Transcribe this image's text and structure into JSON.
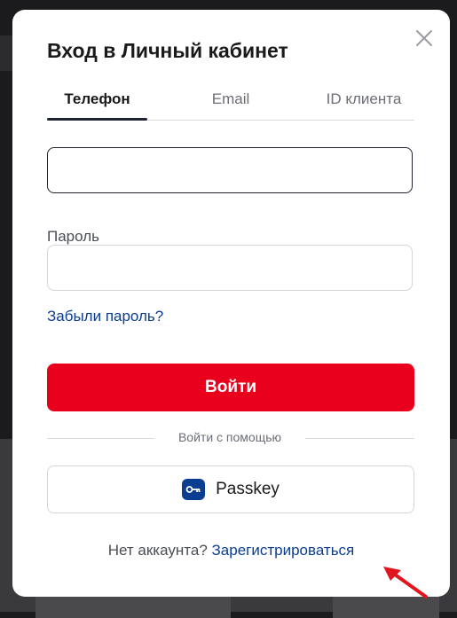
{
  "modal": {
    "title": "Вход в Личный кабинет",
    "tabs": [
      {
        "label": "Телефон",
        "active": true
      },
      {
        "label": "Email",
        "active": false
      },
      {
        "label": "ID клиента",
        "active": false
      }
    ],
    "phone_input": {
      "value": "",
      "placeholder": ""
    },
    "password": {
      "label": "Пароль",
      "value": "",
      "placeholder": ""
    },
    "forgot_link": "Забыли пароль?",
    "login_button": "Войти",
    "divider_text": "Войти с помощью",
    "passkey_button": {
      "label": "Passkey",
      "icon": "key-icon"
    },
    "register": {
      "prompt": "Нет аккаунта?",
      "link": "Зарегистрироваться"
    }
  },
  "colors": {
    "primary_red": "#e8001c",
    "link_blue": "#0b3d91",
    "annotation_arrow": "#e0151d"
  }
}
